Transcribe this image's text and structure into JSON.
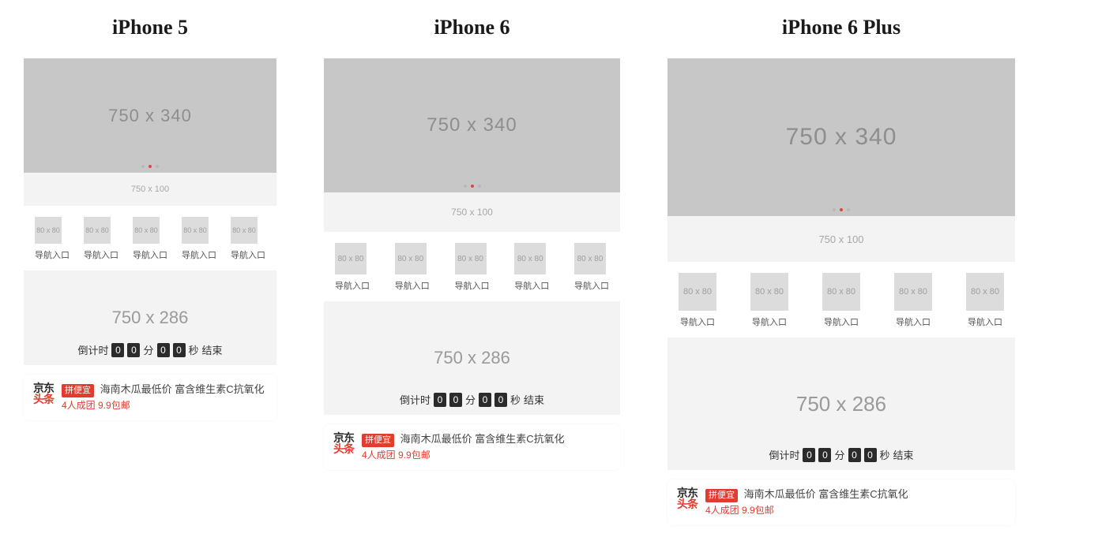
{
  "devices": [
    {
      "title": "iPhone 5"
    },
    {
      "title": "iPhone 6"
    },
    {
      "title": "iPhone 6 Plus"
    }
  ],
  "banner1": {
    "label": "750 x 340"
  },
  "strip": {
    "label": "750 x 100"
  },
  "nav": {
    "icon_label": "80 x 80",
    "items": [
      "导航入口",
      "导航入口",
      "导航入口",
      "导航入口",
      "导航入口"
    ]
  },
  "banner2": {
    "label": "750 x 286"
  },
  "countdown": {
    "prefix": "倒计时",
    "mm": [
      "0",
      "0"
    ],
    "min_unit": "分",
    "ss": [
      "0",
      "0"
    ],
    "sec_unit": "秒",
    "suffix": "结束"
  },
  "news": {
    "logo_top": "京东",
    "logo_bottom": "头条",
    "tag": "拼便宜",
    "headline": "海南木瓜最低价 富含维生素C抗氧化",
    "subline": "4人成团 9.9包邮"
  }
}
